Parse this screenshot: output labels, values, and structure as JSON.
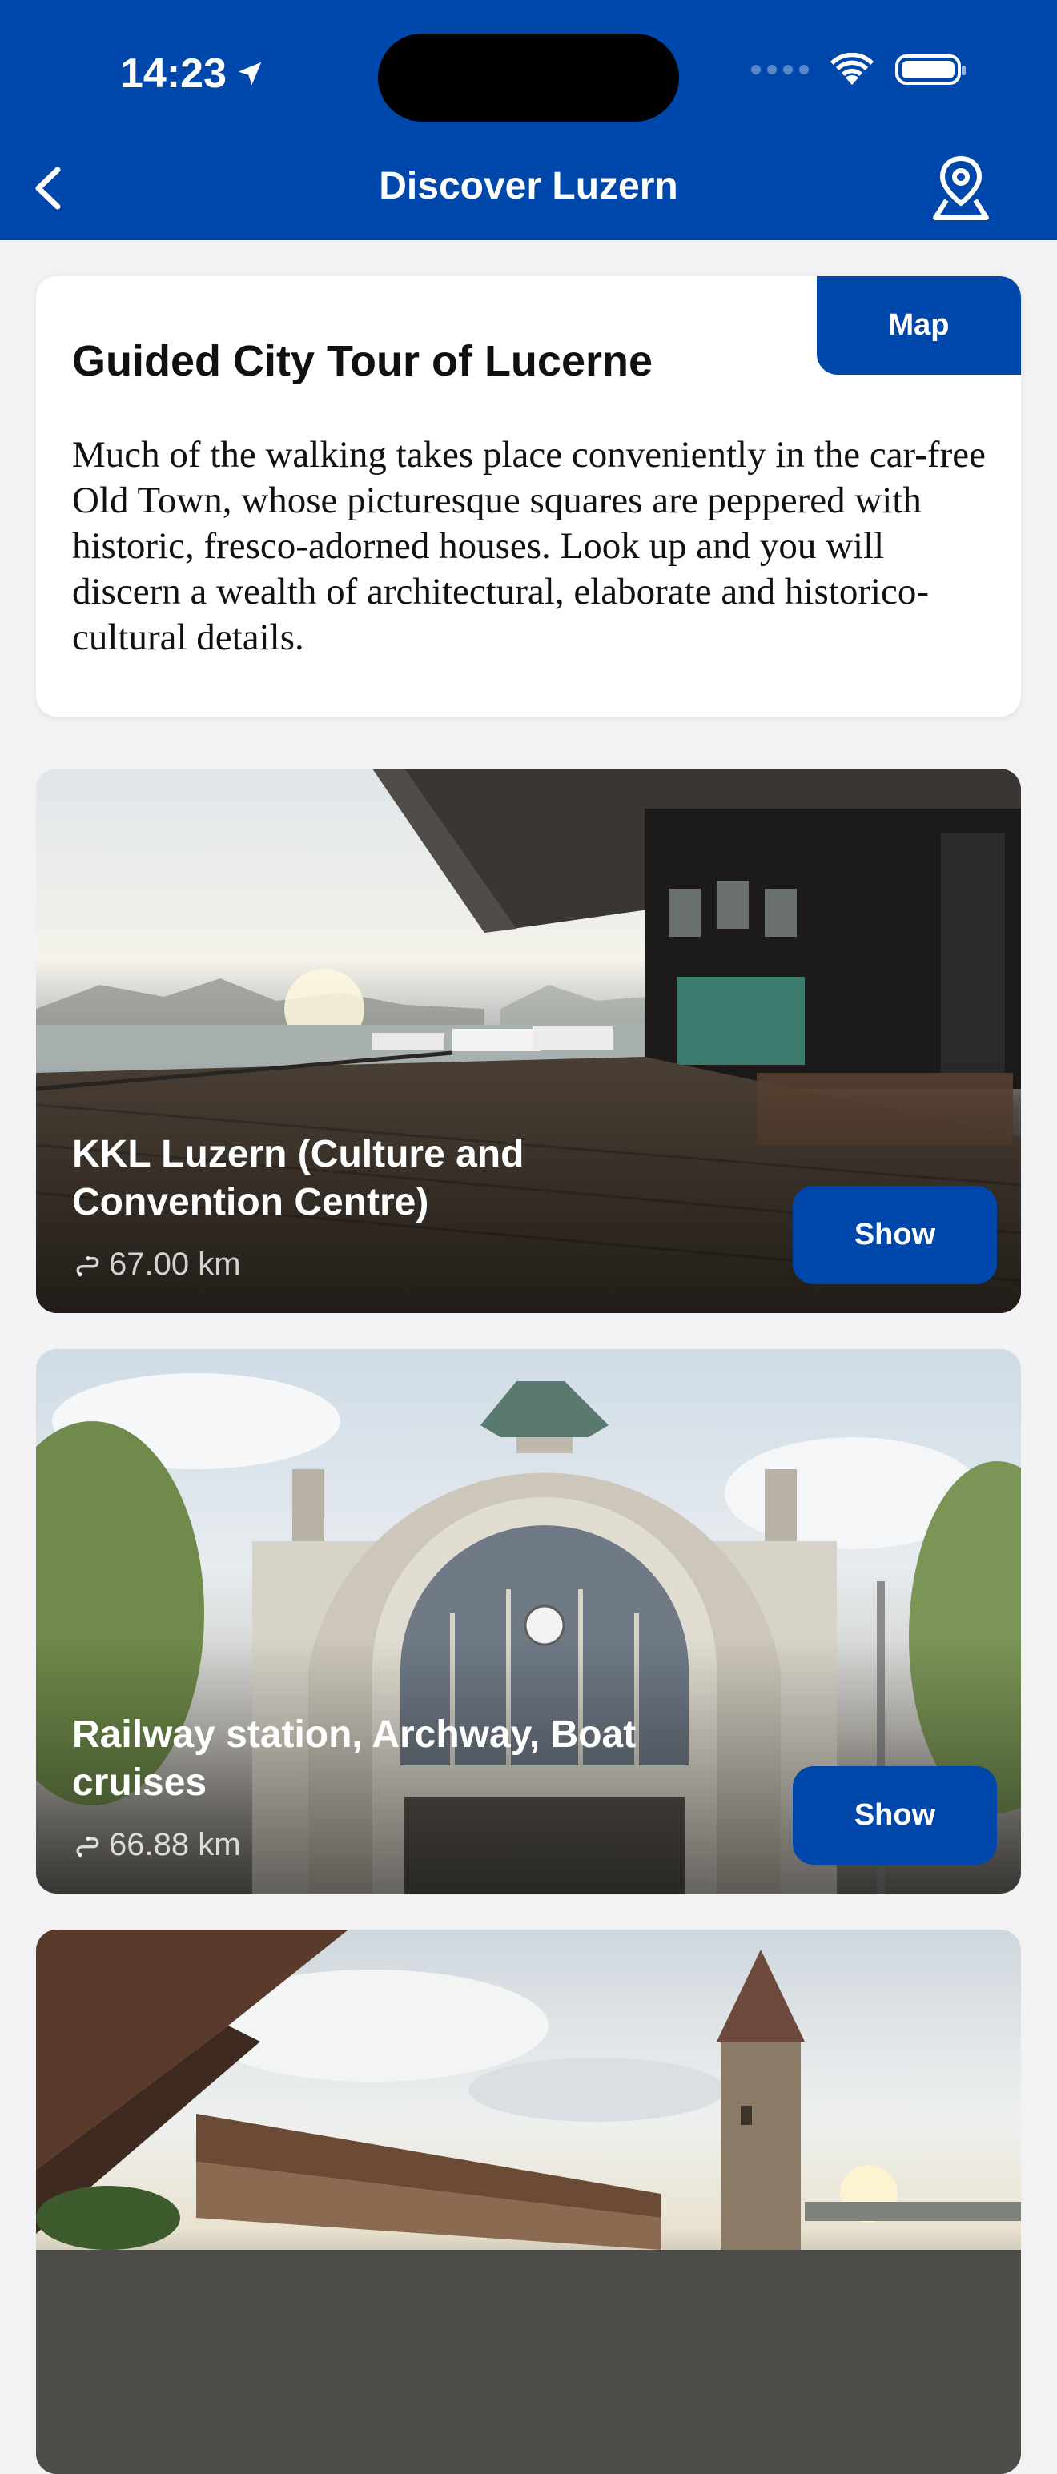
{
  "status_bar": {
    "time": "14:23"
  },
  "nav": {
    "title": "Discover Luzern"
  },
  "intro": {
    "title": "Guided City Tour of Lucerne",
    "map_label": "Map",
    "description": "Much of the walking takes place conveniently in the car-free Old Town, whose picturesque squares are peppered with historic, fresco-adorned houses. Look up and you will discern a wealth of architectural, elaborate and historico-cultural details."
  },
  "places": [
    {
      "title": "KKL Luzern (Culture and Convention Centre)",
      "distance": "67.00 km",
      "button": "Show"
    },
    {
      "title": "Railway station, Archway, Boat cruises",
      "distance": "66.88 km",
      "button": "Show"
    },
    {
      "title": "",
      "distance": "",
      "button": ""
    }
  ],
  "colors": {
    "brand_blue": "#0047ab",
    "background": "#f2f2f4"
  }
}
